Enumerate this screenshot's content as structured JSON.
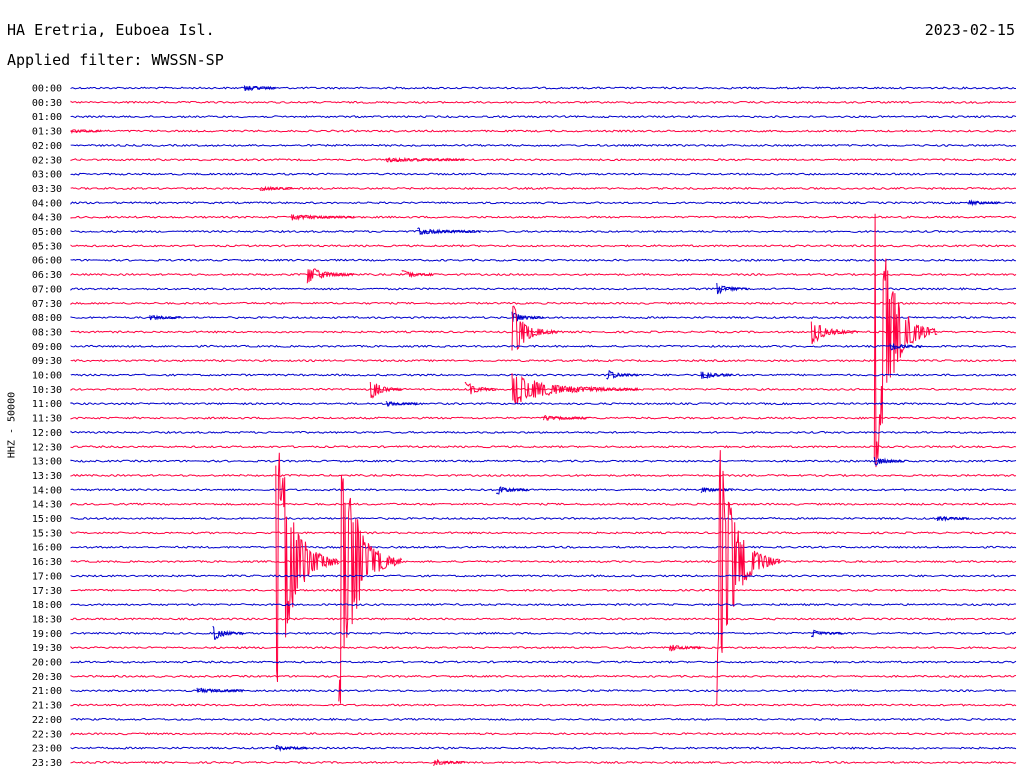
{
  "header": {
    "station": "HA Eretria, Euboea Isl.",
    "filter": "Applied filter: WWSSN-SP",
    "date": "2023-02-15"
  },
  "chart_data": {
    "type": "line",
    "title": "HA Eretria, Euboea Isl.",
    "ylabel": "HHZ - 50000",
    "colors": {
      "even": "#0000cc",
      "odd": "#ff0040"
    },
    "rows": [
      "00:00",
      "00:30",
      "01:00",
      "01:30",
      "02:00",
      "02:30",
      "03:00",
      "03:30",
      "04:00",
      "04:30",
      "05:00",
      "05:30",
      "06:00",
      "06:30",
      "07:00",
      "07:30",
      "08:00",
      "08:30",
      "09:00",
      "09:30",
      "10:00",
      "10:30",
      "11:00",
      "11:30",
      "12:00",
      "12:30",
      "13:00",
      "13:30",
      "14:00",
      "14:30",
      "15:00",
      "15:30",
      "16:00",
      "16:30",
      "17:00",
      "17:30",
      "18:00",
      "18:30",
      "19:00",
      "19:30",
      "20:00",
      "20:30",
      "21:00",
      "21:30",
      "22:00",
      "22:30",
      "23:00",
      "23:30"
    ],
    "row_minutes": 30,
    "events": [
      {
        "row": 0,
        "minute": 5.5,
        "amplitude": 3,
        "coda_minutes": 1
      },
      {
        "row": 3,
        "minute": 0,
        "amplitude": 0.8,
        "coda_minutes": 1
      },
      {
        "row": 5,
        "minute": 10,
        "amplitude": 1.5,
        "coda_minutes": 2.5
      },
      {
        "row": 7,
        "minute": 6,
        "amplitude": 2,
        "coda_minutes": 1
      },
      {
        "row": 8,
        "minute": 28.5,
        "amplitude": 2,
        "coda_minutes": 1
      },
      {
        "row": 9,
        "minute": 7,
        "amplitude": 2.5,
        "coda_minutes": 2
      },
      {
        "row": 10,
        "minute": 11,
        "amplitude": 3,
        "coda_minutes": 2
      },
      {
        "row": 13,
        "minute": 7.5,
        "amplitude": 10,
        "coda_minutes": 1.5
      },
      {
        "row": 13,
        "minute": 10.5,
        "amplitude": 4,
        "coda_minutes": 1
      },
      {
        "row": 14,
        "minute": 20.5,
        "amplitude": 5,
        "coda_minutes": 1
      },
      {
        "row": 16,
        "minute": 2.5,
        "amplitude": 2,
        "coda_minutes": 1
      },
      {
        "row": 16,
        "minute": 14,
        "amplitude": 6,
        "coda_minutes": 1
      },
      {
        "row": 17,
        "minute": 14,
        "amplitude": 30,
        "coda_minutes": 1.5
      },
      {
        "row": 17,
        "minute": 23.5,
        "amplitude": 14,
        "coda_minutes": 1.5
      },
      {
        "row": 17,
        "minute": 25.5,
        "amplitude": 170,
        "coda_minutes": 2
      },
      {
        "row": 18,
        "minute": 26,
        "amplitude": 4,
        "coda_minutes": 1
      },
      {
        "row": 20,
        "minute": 17,
        "amplitude": 5,
        "coda_minutes": 1
      },
      {
        "row": 20,
        "minute": 20,
        "amplitude": 5,
        "coda_minutes": 1
      },
      {
        "row": 21,
        "minute": 9.5,
        "amplitude": 12,
        "coda_minutes": 1
      },
      {
        "row": 21,
        "minute": 12.5,
        "amplitude": 10,
        "coda_minutes": 1
      },
      {
        "row": 21,
        "minute": 14,
        "amplitude": 18,
        "coda_minutes": 4
      },
      {
        "row": 22,
        "minute": 10,
        "amplitude": 2,
        "coda_minutes": 1
      },
      {
        "row": 23,
        "minute": 15,
        "amplitude": 2,
        "coda_minutes": 1.5
      },
      {
        "row": 26,
        "minute": 25.5,
        "amplitude": 4,
        "coda_minutes": 1
      },
      {
        "row": 28,
        "minute": 13.5,
        "amplitude": 5,
        "coda_minutes": 1
      },
      {
        "row": 28,
        "minute": 20,
        "amplitude": 2,
        "coda_minutes": 1
      },
      {
        "row": 30,
        "minute": 27.5,
        "amplitude": 2,
        "coda_minutes": 1
      },
      {
        "row": 33,
        "minute": 6.5,
        "amplitude": 160,
        "coda_minutes": 2
      },
      {
        "row": 33,
        "minute": 8.5,
        "amplitude": 170,
        "coda_minutes": 2
      },
      {
        "row": 33,
        "minute": 20.5,
        "amplitude": 150,
        "coda_minutes": 2
      },
      {
        "row": 38,
        "minute": 4.5,
        "amplitude": 8,
        "coda_minutes": 1
      },
      {
        "row": 38,
        "minute": 23.5,
        "amplitude": 3,
        "coda_minutes": 1
      },
      {
        "row": 39,
        "minute": 19,
        "amplitude": 3,
        "coda_minutes": 1
      },
      {
        "row": 42,
        "minute": 4,
        "amplitude": 2,
        "coda_minutes": 1.5
      },
      {
        "row": 46,
        "minute": 6.5,
        "amplitude": 2,
        "coda_minutes": 1
      },
      {
        "row": 47,
        "minute": 11.5,
        "amplitude": 3,
        "coda_minutes": 1
      }
    ]
  }
}
